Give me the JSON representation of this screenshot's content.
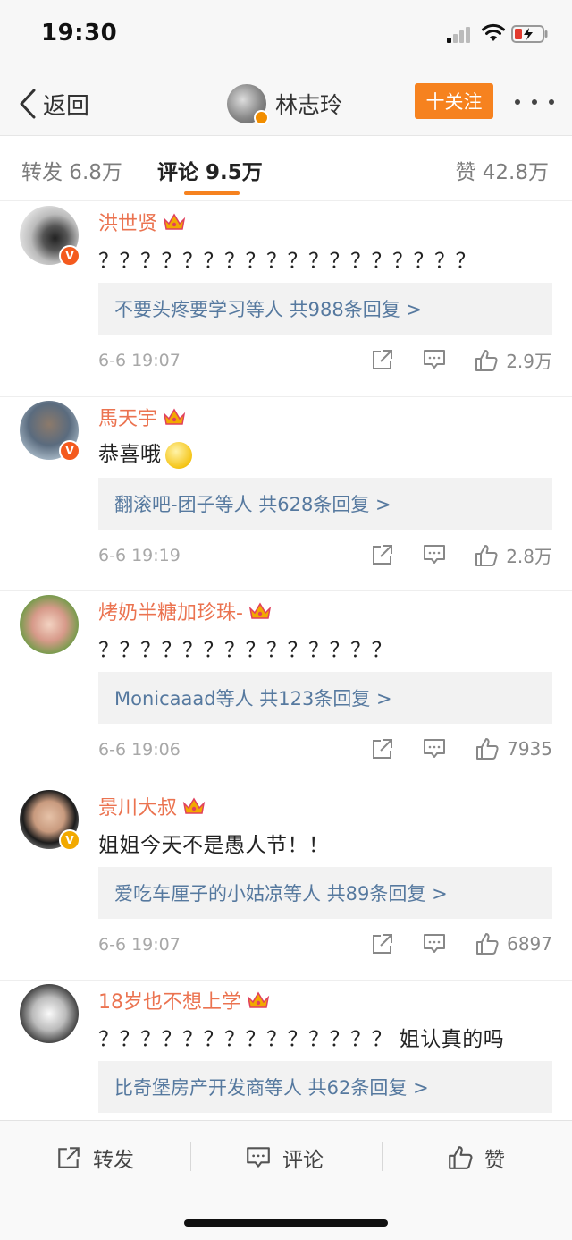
{
  "status_bar": {
    "time": "19:30"
  },
  "nav": {
    "back_label": "返回",
    "user_name": "林志玲",
    "follow_label": "十关注"
  },
  "tabs": {
    "repost": "转发 6.8万",
    "comments": "评论 9.5万",
    "likes": "赞 42.8万"
  },
  "comments": [
    {
      "username": "洪世贤",
      "text": "？？？？？？？？？？？？？？？？？？",
      "replies": "不要头疼要学习等人  共988条回复 >",
      "time": "6-6 19:07",
      "likes": "2.9万"
    },
    {
      "username": "馬天宇",
      "text": "恭喜哦",
      "replies": "翻滚吧-团子等人  共628条回复 >",
      "time": "6-6 19:19",
      "likes": "2.8万"
    },
    {
      "username": "烤奶半糖加珍珠-",
      "text": "？？？？？？？？？？？？？？",
      "replies": "Monicaaad等人  共123条回复 >",
      "time": "6-6 19:06",
      "likes": "7935"
    },
    {
      "username": "景川大叔",
      "text": "姐姐今天不是愚人节！！",
      "replies": "爱吃车厘子的小姑凉等人  共89条回复 >",
      "time": "6-6 19:07",
      "likes": "6897"
    },
    {
      "username": "18岁也不想上学",
      "text": "？？？？？？？？？？？？？？ 姐认真的吗",
      "replies": "比奇堡房产开发商等人  共62条回复 >",
      "time": "",
      "likes": ""
    }
  ],
  "bottom_bar": {
    "repost": "转发",
    "comment": "评论",
    "like": "赞"
  },
  "colors": {
    "accent_orange": "#f6821f",
    "username_orange": "#eb7350",
    "reply_link_blue": "#56799f"
  }
}
